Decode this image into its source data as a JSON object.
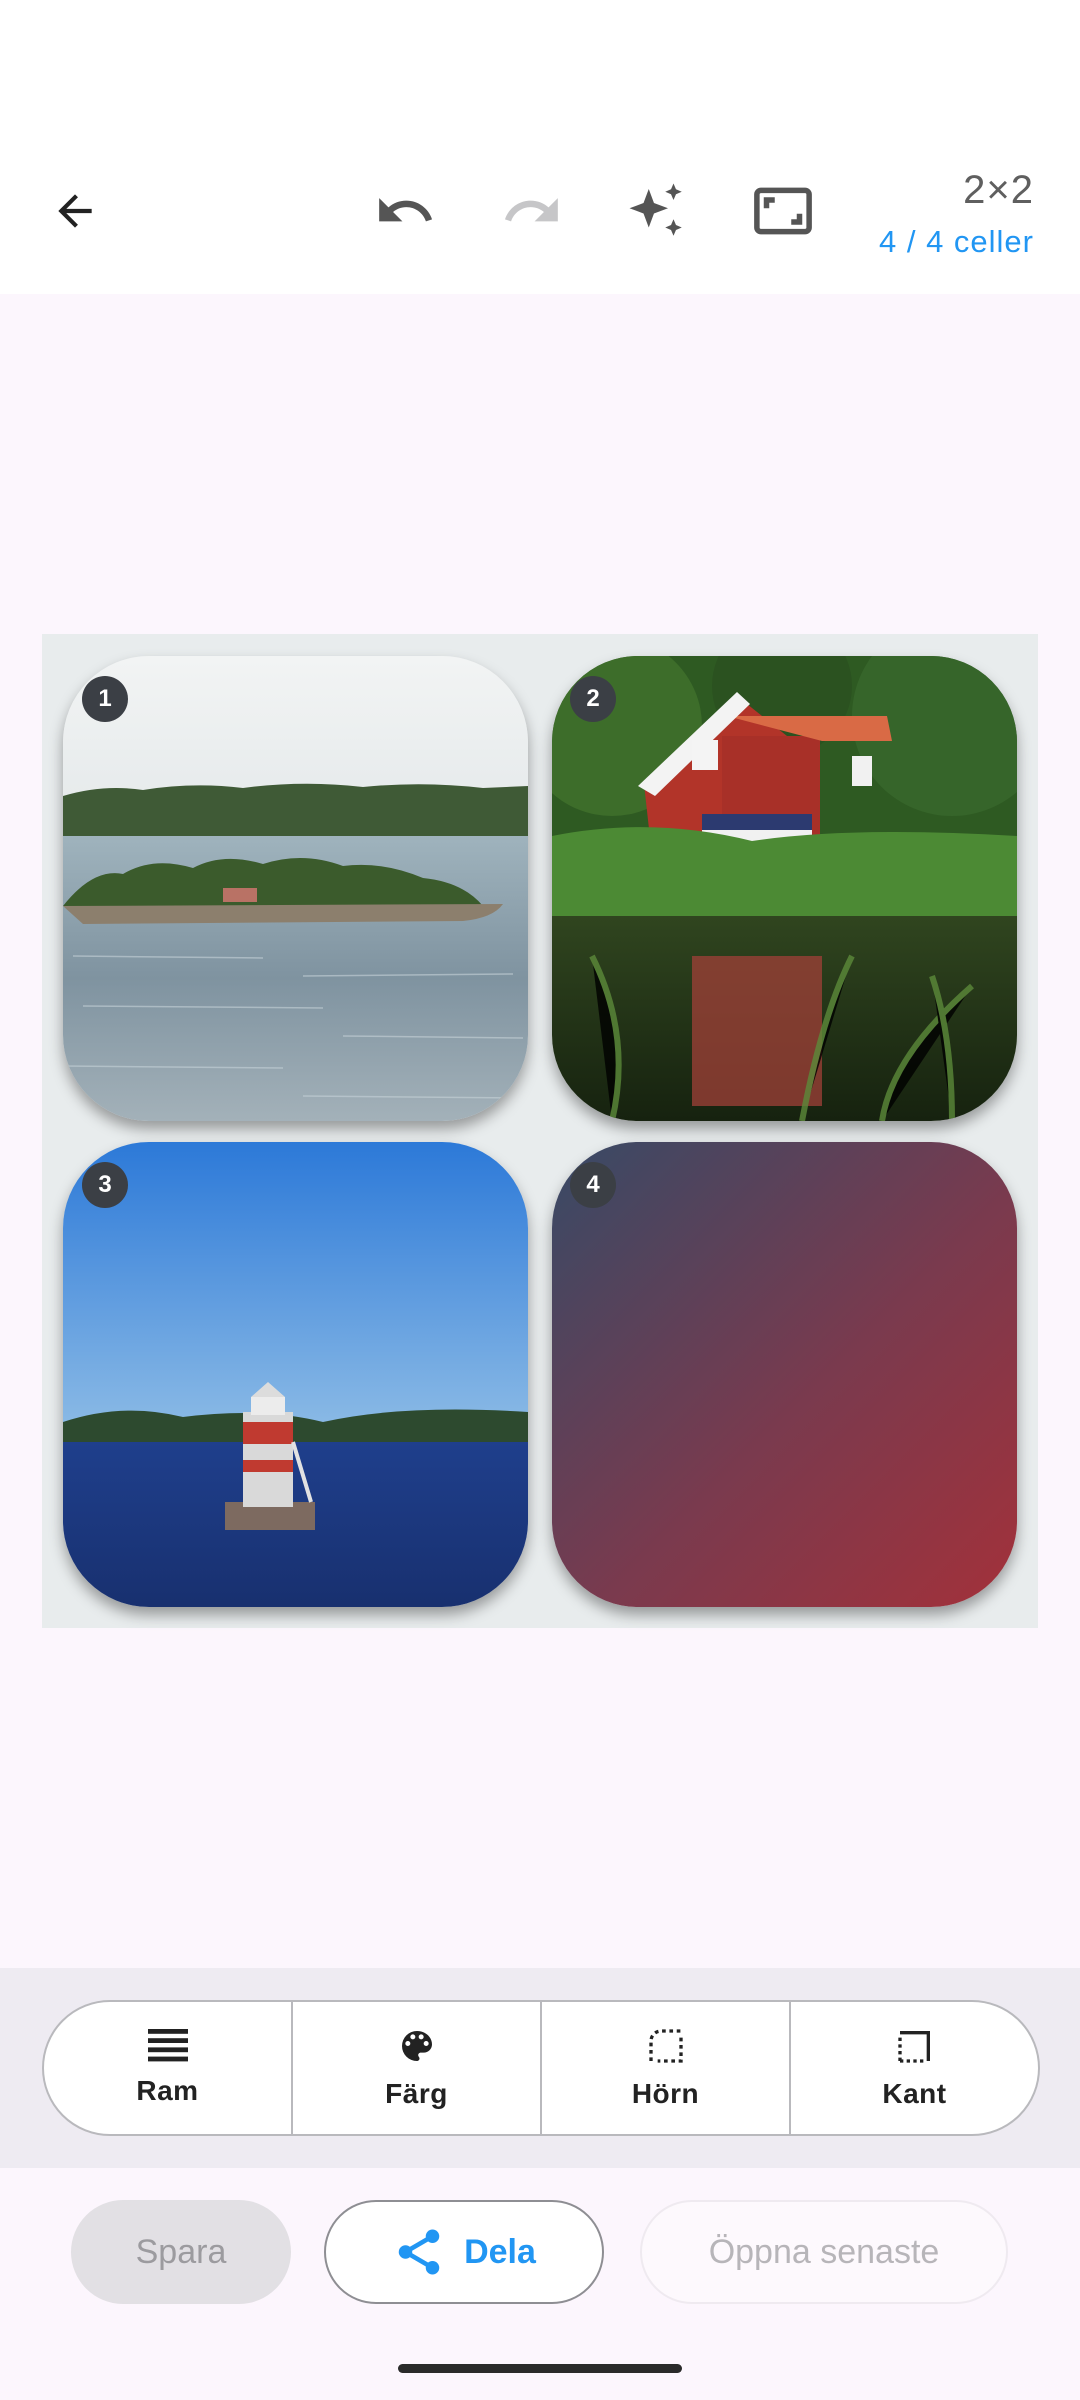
{
  "header": {
    "back_icon": "arrow-left-icon",
    "undo_icon": "undo-icon",
    "redo_icon": "redo-icon",
    "magic_icon": "sparkles-icon",
    "fit_icon": "aspect-ratio-icon",
    "grid_size": "2×2",
    "cell_count": "4 / 4 celler"
  },
  "collage": {
    "cells": [
      {
        "number": "1",
        "content": "photo-archipelago-island"
      },
      {
        "number": "2",
        "content": "photo-red-house-lake"
      },
      {
        "number": "3",
        "content": "photo-lighthouse-sea"
      },
      {
        "number": "4",
        "content": "gradient-fill"
      }
    ],
    "gradient": {
      "from": "#374a66",
      "to": "#a3313a"
    }
  },
  "tools": [
    {
      "label": "Ram",
      "icon": "lines-icon"
    },
    {
      "label": "Färg",
      "icon": "palette-icon"
    },
    {
      "label": "Hörn",
      "icon": "corner-icon"
    },
    {
      "label": "Kant",
      "icon": "border-icon"
    }
  ],
  "actions": {
    "save": "Spara",
    "share": "Dela",
    "open_recent": "Öppna senaste"
  },
  "colors": {
    "accent": "#2196f3",
    "background": "#fcf6fd"
  }
}
